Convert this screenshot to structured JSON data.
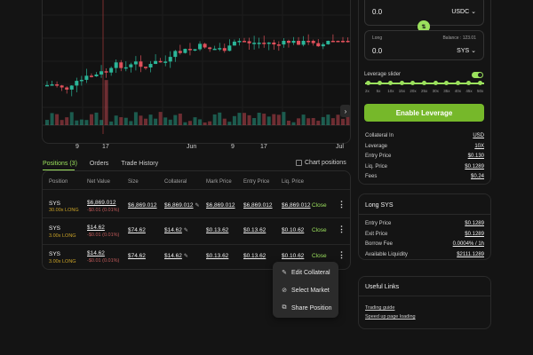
{
  "chart": {
    "x_labels": [
      "9",
      "17",
      "Jun",
      "9",
      "17",
      "Jul"
    ],
    "arrow_icon": "chevron-right-icon",
    "colors": {
      "up": "#2bb598",
      "down": "#e0505b",
      "bg": "#121212"
    }
  },
  "tabs": [
    {
      "label": "Positions (3)",
      "active": true
    },
    {
      "label": "Orders",
      "active": false
    },
    {
      "label": "Trade History",
      "active": false
    }
  ],
  "chart_positions_label": "Chart positions",
  "table": {
    "headers": [
      "Position",
      "Net Value",
      "Size",
      "Collateral",
      "Mark Price",
      "Entry Price",
      "Liq. Price"
    ],
    "rows": [
      {
        "symbol": "SYS",
        "leverage": "30.00x LONG",
        "net_value": "$6,869.012",
        "net_change": "-$0.01 (0.01%)",
        "size": "$6,869.012",
        "collateral": "$6,869.012",
        "mark_price": "$6,869.012",
        "entry_price": "$6,869.012",
        "liq_price": "$6,869.012",
        "action": "Close"
      },
      {
        "symbol": "SYS",
        "leverage": "3.00x LONG",
        "net_value": "$14.62",
        "net_change": "-$0.01 (0.01%)",
        "size": "$74.62",
        "collateral": "$14.62",
        "mark_price": "$0.13.62",
        "entry_price": "$0.13.62",
        "liq_price": "$0.10.62",
        "action": "Close"
      },
      {
        "symbol": "SYS",
        "leverage": "3.00x LONG",
        "net_value": "$14.62",
        "net_change": "-$0.01 (0.01%)",
        "size": "$74.62",
        "collateral": "$14.62",
        "mark_price": "$0.13.62",
        "entry_price": "$0.13.62",
        "liq_price": "$0.10.62",
        "action": "Close"
      }
    ]
  },
  "menu": {
    "items": [
      {
        "label": "Edit Collateral",
        "icon": "pencil-icon"
      },
      {
        "label": "Select Market",
        "icon": "check-circle-icon"
      },
      {
        "label": "Share Position",
        "icon": "share-icon"
      }
    ]
  },
  "trade_panel": {
    "pay": {
      "value": "0.0",
      "token": "USDC"
    },
    "swap_icon": "swap-icon",
    "long": {
      "label": "Long",
      "balance": "Balance : 123.01",
      "value": "0.0",
      "token": "SYS"
    },
    "leverage_label": "Leverage slider",
    "leverage_toggle": true,
    "slider_ticks": [
      "2x",
      "5x",
      "10x",
      "15x",
      "20x",
      "25x",
      "30x",
      "35x",
      "40x",
      "45x",
      "50x"
    ],
    "slider_fraction": 1.0,
    "enable_label": "Enable Leverage",
    "details": [
      {
        "label": "Collateral In",
        "value": "USD"
      },
      {
        "label": "Leverage",
        "value": "10X"
      },
      {
        "label": "Entry Price",
        "value": "$0.130"
      },
      {
        "label": "Liq. Price",
        "value": "$0.1289"
      },
      {
        "label": "Fees",
        "value": "$0.24"
      }
    ]
  },
  "long_card": {
    "title": "Long SYS",
    "details": [
      {
        "label": "Entry Price",
        "value": "$0.1289"
      },
      {
        "label": "Exit Price",
        "value": "$0.1289"
      },
      {
        "label": "Borrow Fee",
        "value": "0.0004% / 1h"
      },
      {
        "label": "Available Liquidity",
        "value": "$2111.1289"
      }
    ]
  },
  "links_card": {
    "title": "Useful Links",
    "links": [
      "Trading guide",
      "Speed up page loading"
    ]
  }
}
